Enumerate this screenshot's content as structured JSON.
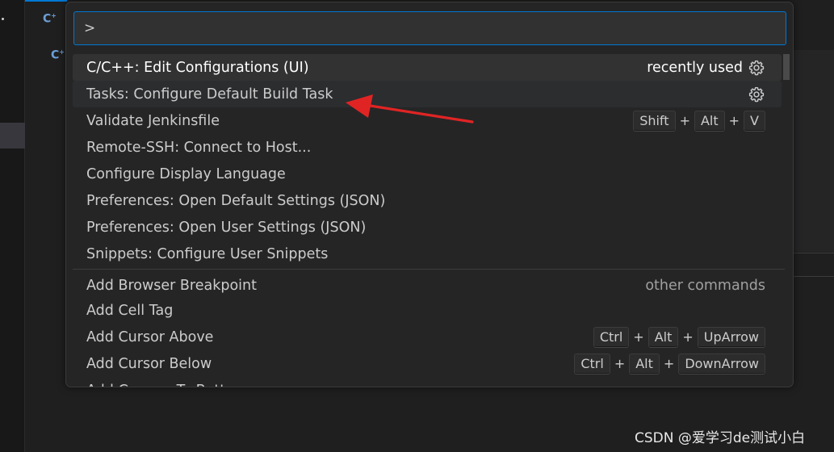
{
  "background": {
    "cpp_icon_label": "C",
    "cpp_icon_sup": "+"
  },
  "quick_pick": {
    "input_value": ">",
    "items": [
      {
        "label": "C/C++: Edit Configurations (UI)",
        "description": "recently used",
        "icon": "gear-icon",
        "state": "focused"
      },
      {
        "label": "Tasks: Configure Default Build Task",
        "description": "",
        "icon": "gear-icon",
        "state": "hovered"
      },
      {
        "label": "Validate Jenkinsfile",
        "keys": [
          "Shift",
          "Alt",
          "V"
        ]
      },
      {
        "label": "Remote-SSH: Connect to Host..."
      },
      {
        "label": "Configure Display Language"
      },
      {
        "label": "Preferences: Open Default Settings (JSON)"
      },
      {
        "label": "Preferences: Open User Settings (JSON)"
      },
      {
        "label": "Snippets: Configure User Snippets"
      },
      {
        "label": "Add Browser Breakpoint",
        "description": "other commands"
      },
      {
        "label": "Add Cell Tag"
      },
      {
        "label": "Add Cursor Above",
        "keys": [
          "Ctrl",
          "Alt",
          "UpArrow"
        ]
      },
      {
        "label": "Add Cursor Below",
        "keys": [
          "Ctrl",
          "Alt",
          "DownArrow"
        ]
      },
      {
        "label": "Add Cursors To Bottom"
      }
    ],
    "key_separator": "+"
  },
  "watermark": "CSDN @爱学习de测试小白",
  "colors": {
    "accent": "#0078d4",
    "annotation_arrow": "#e02424"
  }
}
